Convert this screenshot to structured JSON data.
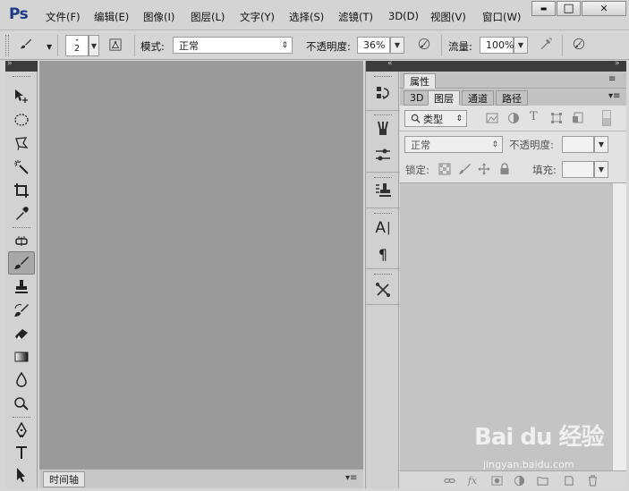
{
  "app": {
    "logo": "Ps",
    "menu": [
      "文件(F)",
      "编辑(E)",
      "图像(I)",
      "图层(L)",
      "文字(Y)",
      "选择(S)",
      "滤镜(T)",
      "3D(D)",
      "视图(V)",
      "窗口(W)"
    ],
    "window_controls": {
      "minimize": "▬",
      "maximize": "□",
      "close": "✕"
    }
  },
  "options": {
    "brush_size": "2",
    "mode_label": "模式:",
    "mode_value": "正常",
    "opacity_label": "不透明度:",
    "opacity_value": "36%",
    "flow_label": "流量:",
    "flow_value": "100%"
  },
  "tools": [
    {
      "name": "move-tool-icon"
    },
    {
      "name": "elliptical-marquee-tool-icon"
    },
    {
      "name": "polygonal-lasso-tool-icon"
    },
    {
      "name": "magic-wand-tool-icon"
    },
    {
      "name": "crop-tool-icon"
    },
    {
      "name": "eyedropper-tool-icon"
    },
    {
      "name": "spot-healing-tool-icon"
    },
    {
      "name": "brush-tool-icon",
      "selected": true
    },
    {
      "name": "clone-stamp-tool-icon"
    },
    {
      "name": "history-brush-tool-icon"
    },
    {
      "name": "eraser-tool-icon"
    },
    {
      "name": "gradient-tool-icon"
    },
    {
      "name": "blur-tool-icon"
    },
    {
      "name": "dodge-tool-icon"
    },
    {
      "name": "pen-tool-icon"
    },
    {
      "name": "type-tool-icon"
    },
    {
      "name": "path-selection-tool-icon"
    }
  ],
  "timeline": {
    "tab": "时间轴"
  },
  "dock": {
    "text_icon": "A",
    "paragraph_icon": "¶"
  },
  "panels": {
    "properties_tab": "属性",
    "tabs": [
      "3D",
      "图层",
      "通道",
      "路径"
    ],
    "active_tab": "图层",
    "filter_kind": "类型",
    "blend_mode": "正常",
    "opacity_label": "不透明度:",
    "lock_label": "锁定:",
    "fill_label": "填充:"
  },
  "watermark": {
    "text": "Bai du 经验",
    "sub": "jingyan.baidu.com"
  }
}
